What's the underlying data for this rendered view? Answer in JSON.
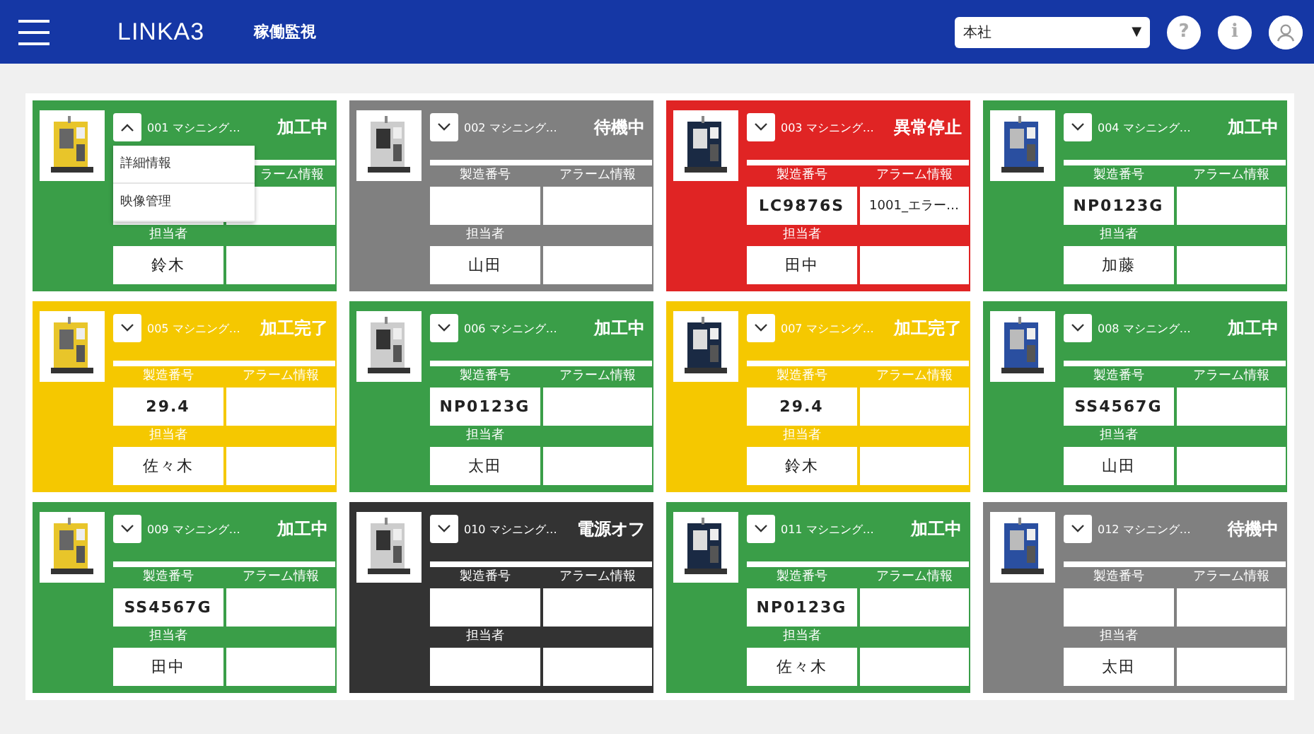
{
  "header": {
    "logo": "LINKA3",
    "title": "稼働監視",
    "location_select": {
      "value": "本社",
      "arrow": "▼"
    },
    "help_button": "?",
    "info_button": "i"
  },
  "machines": [
    {
      "name": "001 マシニング…",
      "status": "加工中",
      "color": "#3a9e48",
      "expanded": true,
      "menu": [
        "詳細情報",
        "映像管理"
      ],
      "alarm_label": "ラーム情報",
      "person_label": "担当者",
      "person": "鈴木"
    },
    {
      "name": "002 マシニング…",
      "status": "待機中",
      "color": "#808080",
      "expanded": false,
      "serial_label": "製造番号",
      "alarm_label": "アラーム情報",
      "person_label": "担当者",
      "person": "山田"
    },
    {
      "name": "003 マシニング…",
      "status": "異常停止",
      "color": "#e02424",
      "expanded": false,
      "serial_label": "製造番号",
      "alarm_label": "アラーム情報",
      "serial": "LC9876S",
      "alarm": "1001_エラー…",
      "person_label": "担当者",
      "person": "田中"
    },
    {
      "name": "004 マシニング…",
      "status": "加工中",
      "color": "#3a9e48",
      "expanded": false,
      "serial_label": "製造番号",
      "alarm_label": "アラーム情報",
      "serial": "NP0123G",
      "person_label": "担当者",
      "person": "加藤"
    },
    {
      "name": "005 マシニング…",
      "status": "加工完了",
      "color": "#f5c800",
      "expanded": false,
      "serial_label": "製造番号",
      "alarm_label": "アラーム情報",
      "serial": "29.4",
      "person_label": "担当者",
      "person": "佐々木"
    },
    {
      "name": "006 マシニング…",
      "status": "加工中",
      "color": "#3a9e48",
      "expanded": false,
      "serial_label": "製造番号",
      "alarm_label": "アラーム情報",
      "serial": "NP0123G",
      "person_label": "担当者",
      "person": "太田"
    },
    {
      "name": "007 マシニング…",
      "status": "加工完了",
      "color": "#f5c800",
      "expanded": false,
      "serial_label": "製造番号",
      "alarm_label": "アラーム情報",
      "serial": "29.4",
      "person_label": "担当者",
      "person": "鈴木"
    },
    {
      "name": "008 マシニング…",
      "status": "加工中",
      "color": "#3a9e48",
      "expanded": false,
      "serial_label": "製造番号",
      "alarm_label": "アラーム情報",
      "serial": "SS4567G",
      "person_label": "担当者",
      "person": "山田"
    },
    {
      "name": "009 マシニング…",
      "status": "加工中",
      "color": "#3a9e48",
      "expanded": false,
      "serial_label": "製造番号",
      "alarm_label": "アラーム情報",
      "serial": "SS4567G",
      "person_label": "担当者",
      "person": "田中"
    },
    {
      "name": "010 マシニング…",
      "status": "電源オフ",
      "color": "#333333",
      "expanded": false,
      "serial_label": "製造番号",
      "alarm_label": "アラーム情報",
      "person_label": "担当者"
    },
    {
      "name": "011 マシニング…",
      "status": "加工中",
      "color": "#3a9e48",
      "expanded": false,
      "serial_label": "製造番号",
      "alarm_label": "アラーム情報",
      "serial": "NP0123G",
      "person_label": "担当者",
      "person": "佐々木"
    },
    {
      "name": "012 マシニング…",
      "status": "待機中",
      "color": "#808080",
      "expanded": false,
      "serial_label": "製造番号",
      "alarm_label": "アラーム情報",
      "person_label": "担当者",
      "person": "太田"
    }
  ]
}
